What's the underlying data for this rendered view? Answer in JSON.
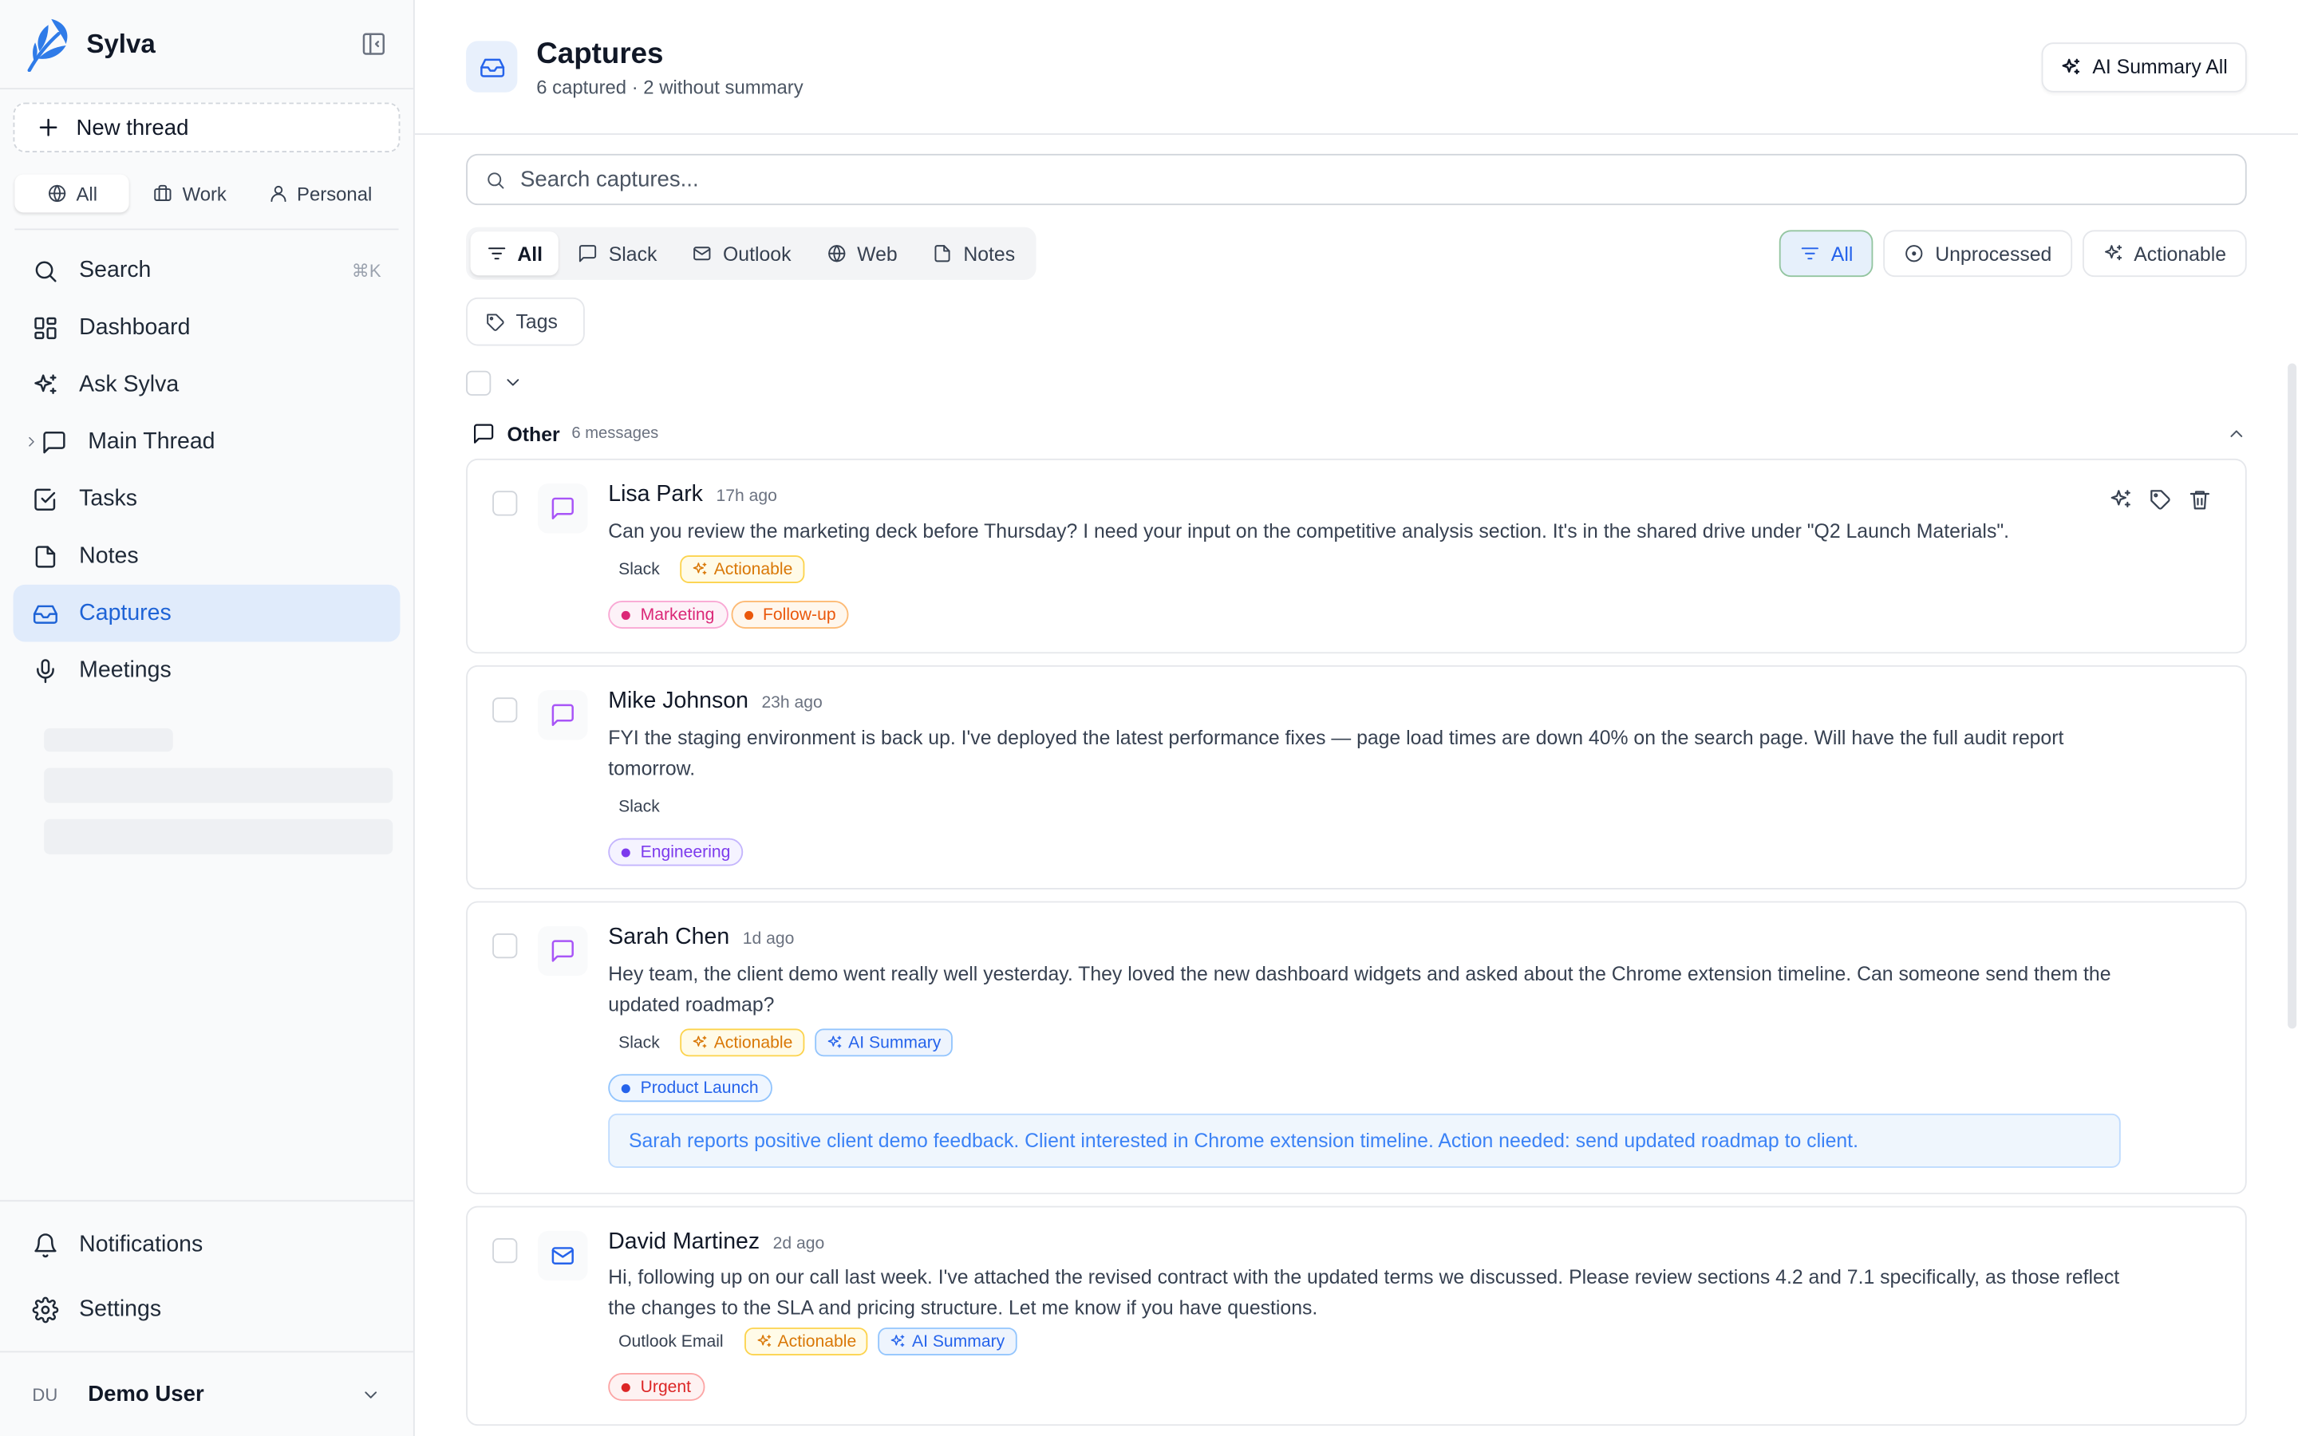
{
  "app": {
    "name": "Sylva"
  },
  "sidebar": {
    "new_thread": "New thread",
    "scopes": [
      {
        "label": "All",
        "icon": "globe-icon",
        "active": true
      },
      {
        "label": "Work",
        "icon": "briefcase-icon",
        "active": false
      },
      {
        "label": "Personal",
        "icon": "user-icon",
        "active": false
      }
    ],
    "nav": [
      {
        "label": "Search",
        "icon": "search-icon",
        "shortcut": "⌘K"
      },
      {
        "label": "Dashboard",
        "icon": "dashboard-icon"
      },
      {
        "label": "Ask Sylva",
        "icon": "sparkles-icon"
      },
      {
        "label": "Main Thread",
        "icon": "chat-icon"
      },
      {
        "label": "Tasks",
        "icon": "checkbox-icon"
      },
      {
        "label": "Notes",
        "icon": "file-icon"
      },
      {
        "label": "Captures",
        "icon": "inbox-icon",
        "active": true
      },
      {
        "label": "Meetings",
        "icon": "mic-icon"
      }
    ],
    "bottom": [
      {
        "label": "Notifications",
        "icon": "bell-icon"
      },
      {
        "label": "Settings",
        "icon": "gear-icon"
      }
    ],
    "user": {
      "initials": "DU",
      "name": "Demo User"
    }
  },
  "header": {
    "title": "Captures",
    "subtitle": "6 captured · 2 without summary",
    "ai_summary_all": "AI Summary All"
  },
  "search": {
    "placeholder": "Search captures..."
  },
  "source_filters": [
    {
      "label": "All",
      "active": true
    },
    {
      "label": "Slack"
    },
    {
      "label": "Outlook"
    },
    {
      "label": "Web"
    },
    {
      "label": "Notes"
    }
  ],
  "status_filters": [
    {
      "label": "All",
      "active": true
    },
    {
      "label": "Unprocessed"
    },
    {
      "label": "Actionable"
    }
  ],
  "tags_button": "Tags",
  "group": {
    "name": "Other",
    "count": "6 messages"
  },
  "captures": [
    {
      "sender": "Lisa Park",
      "ago": "17h ago",
      "kind": "slack",
      "body": "Can you review the marketing deck before Thursday? I need your input on the competitive analysis section. It's in the shared drive under \"Q2 Launch Materials\".",
      "source": "Slack",
      "actionable": "Actionable",
      "tags": [
        {
          "label": "Marketing",
          "color": "#db2777"
        },
        {
          "label": "Follow-up",
          "color": "#ea580c"
        }
      ]
    },
    {
      "sender": "Mike Johnson",
      "ago": "23h ago",
      "kind": "slack",
      "body": "FYI the staging environment is back up. I've deployed the latest performance fixes — page load times are down 40% on the search page. Will have the full audit report tomorrow.",
      "source": "Slack",
      "tags": [
        {
          "label": "Engineering",
          "color": "#7c3aed"
        }
      ]
    },
    {
      "sender": "Sarah Chen",
      "ago": "1d ago",
      "kind": "slack",
      "body": "Hey team, the client demo went really well yesterday. They loved the new dashboard widgets and asked about the Chrome extension timeline. Can someone send them the updated roadmap?",
      "source": "Slack",
      "actionable": "Actionable",
      "ai": "AI Summary",
      "tags": [
        {
          "label": "Product Launch",
          "color": "#2563eb"
        }
      ],
      "summary": "Sarah reports positive client demo feedback. Client interested in Chrome extension timeline. Action needed: send updated roadmap to client."
    },
    {
      "sender": "David Martinez",
      "ago": "2d ago",
      "kind": "mail",
      "body": "Hi, following up on our call last week. I've attached the revised contract with the updated terms we discussed. Please review sections 4.2 and 7.1 specifically, as those reflect the changes to the SLA and pricing structure. Let me know if you have questions.",
      "source": "Outlook Email",
      "actionable": "Actionable",
      "ai": "AI Summary",
      "tags": [
        {
          "label": "Urgent",
          "color": "#dc2626"
        }
      ]
    }
  ]
}
